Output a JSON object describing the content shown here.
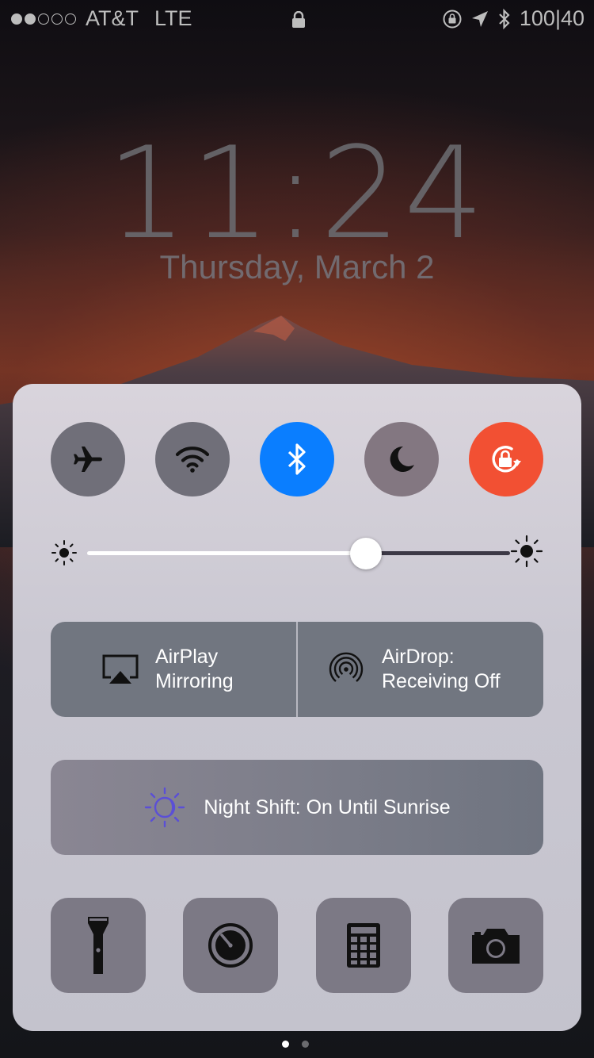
{
  "status_bar": {
    "signal_bars_filled": 2,
    "signal_bars_total": 5,
    "carrier": "AT&T",
    "network": "LTE",
    "center_icon": "lock-icon",
    "battery_text": "100|40",
    "right_icons": [
      "orientation-lock-icon",
      "location-arrow-icon",
      "bluetooth-icon"
    ]
  },
  "lock_screen": {
    "time": "11:24",
    "date": "Thursday, March 2"
  },
  "control_center": {
    "toggles": [
      {
        "name": "airplane-mode",
        "icon": "airplane-icon",
        "active": false,
        "color": "#706f79"
      },
      {
        "name": "wifi",
        "icon": "wifi-icon",
        "active": false,
        "color": "#706f79"
      },
      {
        "name": "bluetooth",
        "icon": "bluetooth-icon",
        "active": true,
        "color": "#0a7eff"
      },
      {
        "name": "do-not-disturb",
        "icon": "moon-icon",
        "active": false,
        "color": "#837781"
      },
      {
        "name": "rotation-lock",
        "icon": "rotation-lock-icon",
        "active": true,
        "color": "#f25033"
      }
    ],
    "brightness": {
      "level": 0.66,
      "min_icon": "sun-small-icon",
      "max_icon": "sun-large-icon"
    },
    "airplay": {
      "line1": "AirPlay",
      "line2": "Mirroring",
      "icon": "airplay-icon"
    },
    "airdrop": {
      "line1": "AirDrop:",
      "line2": "Receiving Off",
      "icon": "airdrop-icon"
    },
    "night_shift": {
      "label": "Night Shift: On Until Sunrise",
      "icon": "night-shift-icon",
      "icon_color": "#5b4fd6"
    },
    "shortcuts": [
      {
        "name": "flashlight",
        "icon": "flashlight-icon"
      },
      {
        "name": "timer",
        "icon": "timer-icon"
      },
      {
        "name": "calculator",
        "icon": "calculator-icon"
      },
      {
        "name": "camera",
        "icon": "camera-icon"
      }
    ]
  },
  "page_indicator": {
    "pages": 2,
    "current": 1
  }
}
